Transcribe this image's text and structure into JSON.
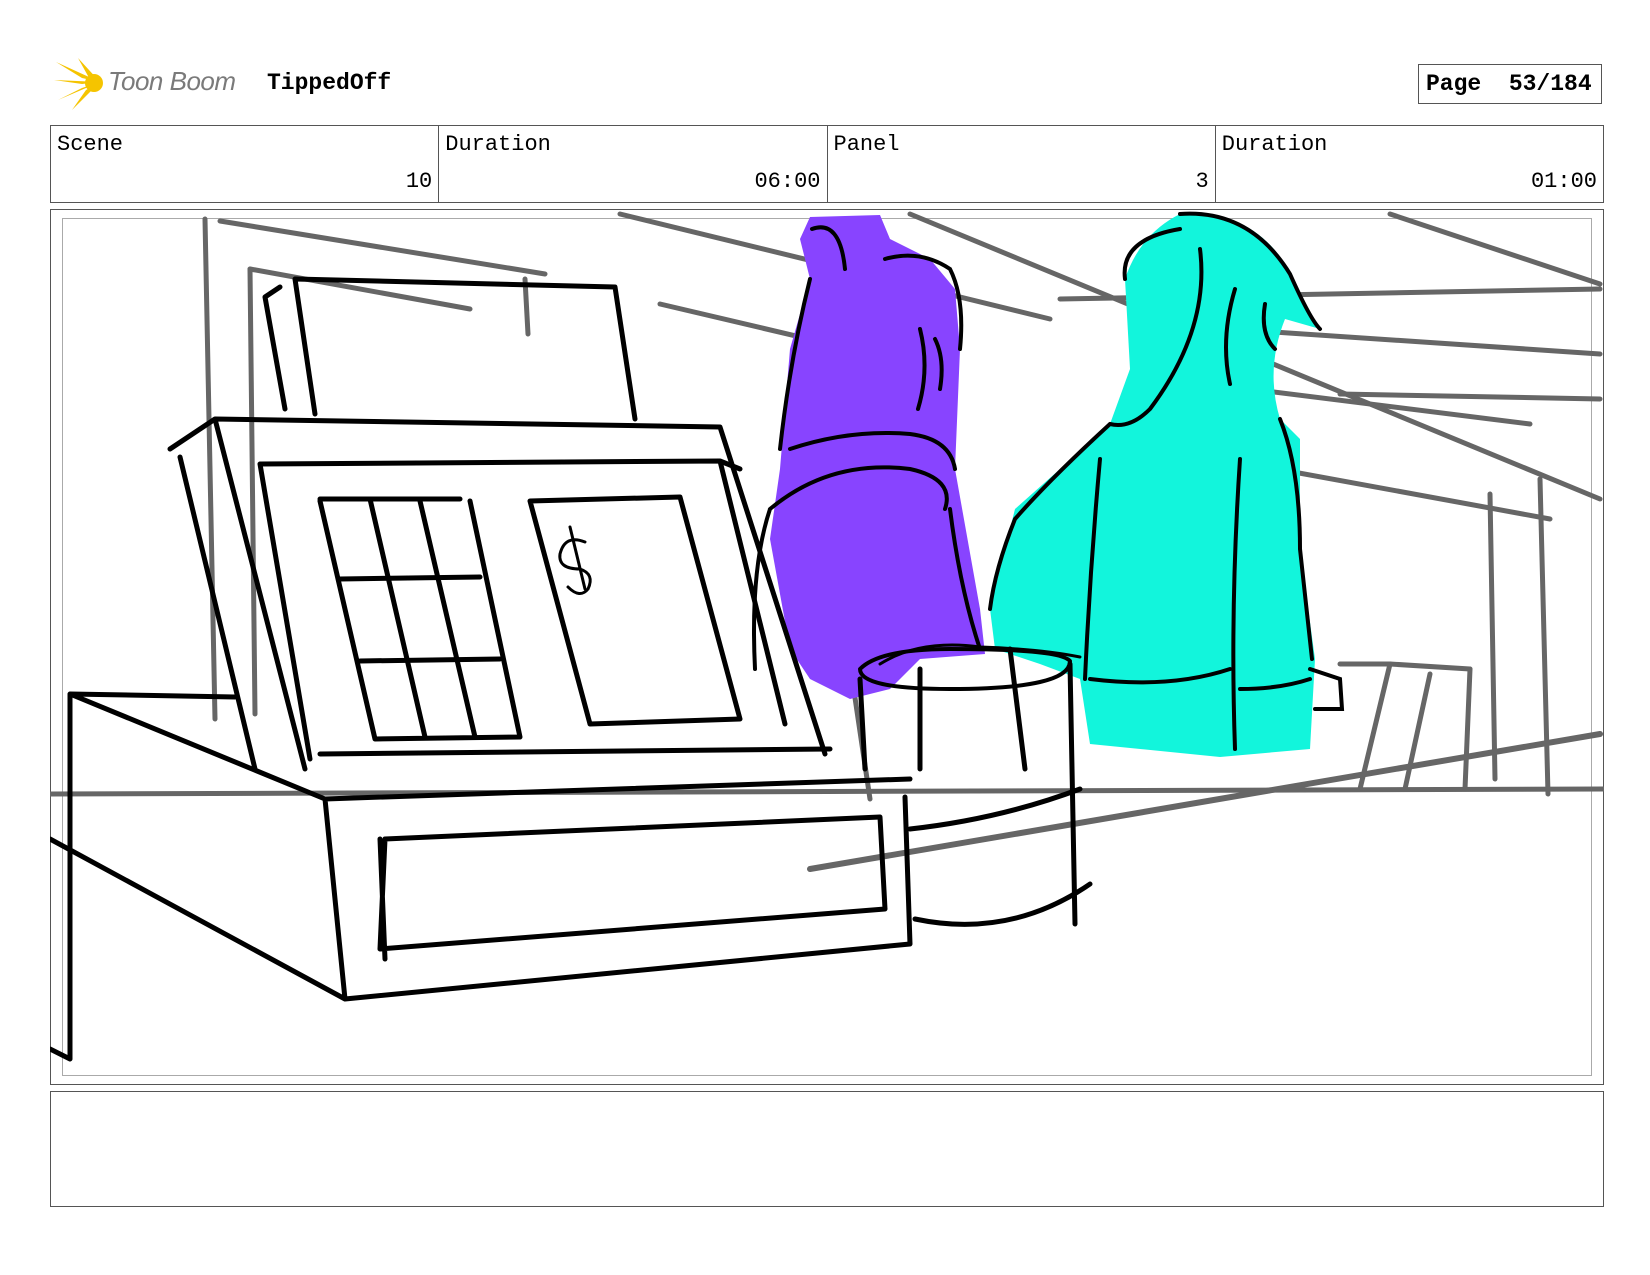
{
  "header": {
    "logo_text": "Toon Boom",
    "project_title": "TippedOff",
    "page_label": "Page",
    "page_value": "53/184"
  },
  "info": {
    "scene_label": "Scene",
    "scene_value": "10",
    "scene_duration_label": "Duration",
    "scene_duration_value": "06:00",
    "panel_label": "Panel",
    "panel_value": "3",
    "panel_duration_label": "Duration",
    "panel_duration_value": "01:00"
  },
  "colors": {
    "character_left": "#8844ff",
    "character_right": "#12f5dc",
    "frame_border": "#555555"
  },
  "notes": {
    "text": ""
  }
}
